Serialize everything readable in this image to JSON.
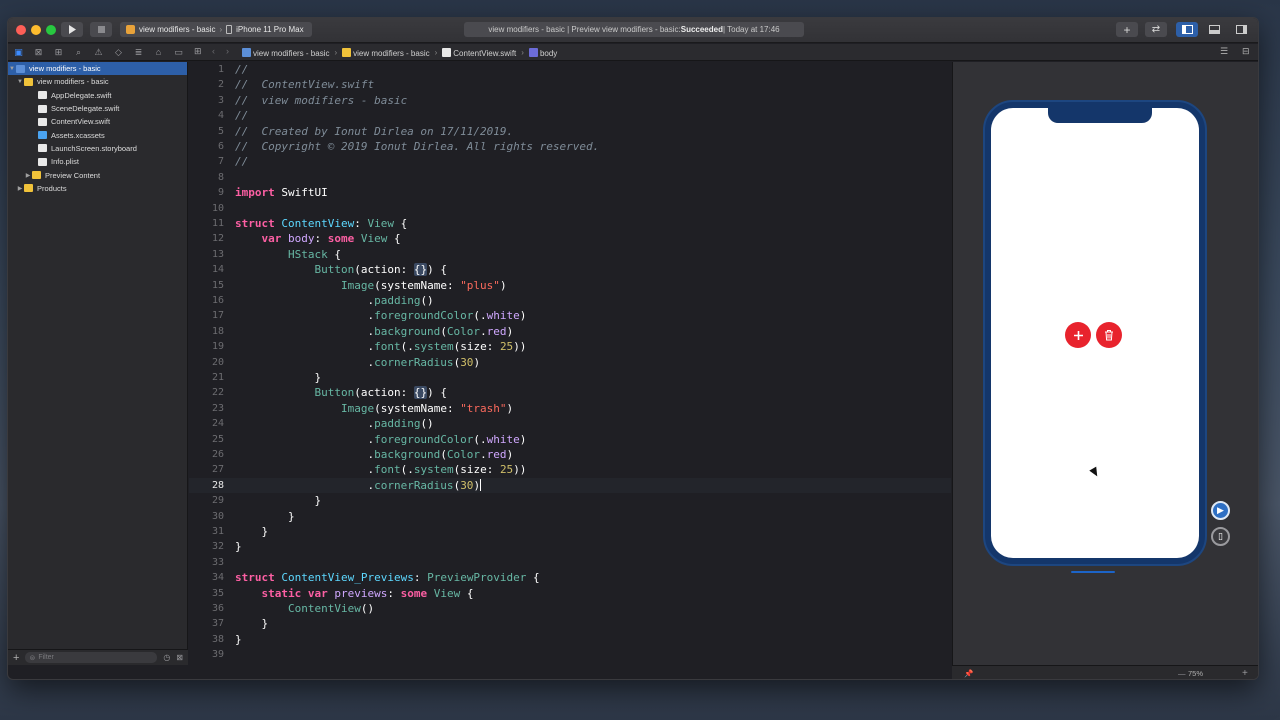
{
  "toolbar": {
    "scheme_project": "view modifiers - basic",
    "scheme_device": "iPhone 11 Pro Max",
    "status_prefix": "view modifiers - basic | Preview view modifiers - basic: ",
    "status_result": "Succeeded",
    "status_time": " | Today at 17:46"
  },
  "breadcrumb": {
    "items": [
      "view modifiers - basic",
      "view modifiers - basic",
      "ContentView.swift",
      "body"
    ]
  },
  "navigator": {
    "items": [
      {
        "label": "view modifiers - basic",
        "icon": "project-icon",
        "expanded": true,
        "selected": true
      },
      {
        "label": "view modifiers - basic",
        "icon": "folder-icon",
        "expanded": true
      },
      {
        "label": "AppDelegate.swift",
        "icon": "swift-file-icon"
      },
      {
        "label": "SceneDelegate.swift",
        "icon": "swift-file-icon"
      },
      {
        "label": "ContentView.swift",
        "icon": "swift-file-icon"
      },
      {
        "label": "Assets.xcassets",
        "icon": "asset-catalog-icon"
      },
      {
        "label": "LaunchScreen.storyboard",
        "icon": "storyboard-icon"
      },
      {
        "label": "Info.plist",
        "icon": "plist-icon"
      },
      {
        "label": "Preview Content",
        "icon": "folder-icon",
        "expanded": false
      },
      {
        "label": "Products",
        "icon": "folder-icon",
        "expanded": false
      }
    ],
    "filter_placeholder": "Filter"
  },
  "editor": {
    "current_line": 28,
    "lines": [
      [
        [
          "c-comment",
          "//"
        ]
      ],
      [
        [
          "c-comment",
          "//  ContentView.swift"
        ]
      ],
      [
        [
          "c-comment",
          "//  view modifiers - basic"
        ]
      ],
      [
        [
          "c-comment",
          "//"
        ]
      ],
      [
        [
          "c-comment",
          "//  Created by Ionut Dirlea on 17/11/2019."
        ]
      ],
      [
        [
          "c-comment",
          "//  Copyright © 2019 Ionut Dirlea. All rights reserved."
        ]
      ],
      [
        [
          "c-comment",
          "//"
        ]
      ],
      [],
      [
        [
          "c-kw",
          "import"
        ],
        [
          "c-plain",
          " SwiftUI"
        ]
      ],
      [],
      [
        [
          "c-kw",
          "struct"
        ],
        [
          "c-plain",
          " "
        ],
        [
          "c-type",
          "ContentView"
        ],
        [
          "c-plain",
          ": "
        ],
        [
          "c-fn",
          "View"
        ],
        [
          "c-plain",
          " {"
        ]
      ],
      [
        [
          "c-plain",
          "    "
        ],
        [
          "c-kw",
          "var"
        ],
        [
          "c-plain",
          " "
        ],
        [
          "c-other",
          "body"
        ],
        [
          "c-plain",
          ": "
        ],
        [
          "c-kw",
          "some"
        ],
        [
          "c-plain",
          " "
        ],
        [
          "c-fn",
          "View"
        ],
        [
          "c-plain",
          " {"
        ]
      ],
      [
        [
          "c-plain",
          "        "
        ],
        [
          "c-fn",
          "HStack"
        ],
        [
          "c-plain",
          " {"
        ]
      ],
      [
        [
          "c-plain",
          "            "
        ],
        [
          "c-fn",
          "Button"
        ],
        [
          "c-plain",
          "(action: "
        ],
        [
          "c-ph",
          "{}"
        ],
        [
          "c-plain",
          ") {"
        ]
      ],
      [
        [
          "c-plain",
          "                "
        ],
        [
          "c-fn",
          "Image"
        ],
        [
          "c-plain",
          "(systemName: "
        ],
        [
          "c-str",
          "\"plus\""
        ],
        [
          "c-plain",
          ")"
        ]
      ],
      [
        [
          "c-plain",
          "                    ."
        ],
        [
          "c-fn",
          "padding"
        ],
        [
          "c-plain",
          "()"
        ]
      ],
      [
        [
          "c-plain",
          "                    ."
        ],
        [
          "c-fn",
          "foregroundColor"
        ],
        [
          "c-plain",
          "(."
        ],
        [
          "c-other",
          "white"
        ],
        [
          "c-plain",
          ")"
        ]
      ],
      [
        [
          "c-plain",
          "                    ."
        ],
        [
          "c-fn",
          "background"
        ],
        [
          "c-plain",
          "("
        ],
        [
          "c-fn",
          "Color"
        ],
        [
          "c-plain",
          "."
        ],
        [
          "c-other",
          "red"
        ],
        [
          "c-plain",
          ")"
        ]
      ],
      [
        [
          "c-plain",
          "                    ."
        ],
        [
          "c-fn",
          "font"
        ],
        [
          "c-plain",
          "(."
        ],
        [
          "c-fn",
          "system"
        ],
        [
          "c-plain",
          "(size: "
        ],
        [
          "c-num",
          "25"
        ],
        [
          "c-plain",
          "))"
        ]
      ],
      [
        [
          "c-plain",
          "                    ."
        ],
        [
          "c-fn",
          "cornerRadius"
        ],
        [
          "c-plain",
          "("
        ],
        [
          "c-num",
          "30"
        ],
        [
          "c-plain",
          ")"
        ]
      ],
      [
        [
          "c-plain",
          "            }"
        ]
      ],
      [
        [
          "c-plain",
          "            "
        ],
        [
          "c-fn",
          "Button"
        ],
        [
          "c-plain",
          "(action: "
        ],
        [
          "c-ph",
          "{}"
        ],
        [
          "c-plain",
          ") {"
        ]
      ],
      [
        [
          "c-plain",
          "                "
        ],
        [
          "c-fn",
          "Image"
        ],
        [
          "c-plain",
          "(systemName: "
        ],
        [
          "c-str",
          "\"trash\""
        ],
        [
          "c-plain",
          ")"
        ]
      ],
      [
        [
          "c-plain",
          "                    ."
        ],
        [
          "c-fn",
          "padding"
        ],
        [
          "c-plain",
          "()"
        ]
      ],
      [
        [
          "c-plain",
          "                    ."
        ],
        [
          "c-fn",
          "foregroundColor"
        ],
        [
          "c-plain",
          "(."
        ],
        [
          "c-other",
          "white"
        ],
        [
          "c-plain",
          ")"
        ]
      ],
      [
        [
          "c-plain",
          "                    ."
        ],
        [
          "c-fn",
          "background"
        ],
        [
          "c-plain",
          "("
        ],
        [
          "c-fn",
          "Color"
        ],
        [
          "c-plain",
          "."
        ],
        [
          "c-other",
          "red"
        ],
        [
          "c-plain",
          ")"
        ]
      ],
      [
        [
          "c-plain",
          "                    ."
        ],
        [
          "c-fn",
          "font"
        ],
        [
          "c-plain",
          "(."
        ],
        [
          "c-fn",
          "system"
        ],
        [
          "c-plain",
          "(size: "
        ],
        [
          "c-num",
          "25"
        ],
        [
          "c-plain",
          "))"
        ]
      ],
      [
        [
          "c-plain",
          "                    ."
        ],
        [
          "c-fn",
          "cornerRadius"
        ],
        [
          "c-plain",
          "("
        ],
        [
          "c-num",
          "30"
        ],
        [
          "c-plain",
          ")"
        ]
      ],
      [
        [
          "c-plain",
          "            }"
        ]
      ],
      [
        [
          "c-plain",
          "        }"
        ]
      ],
      [
        [
          "c-plain",
          "    }"
        ]
      ],
      [
        [
          "c-plain",
          "}"
        ]
      ],
      [],
      [
        [
          "c-kw",
          "struct"
        ],
        [
          "c-plain",
          " "
        ],
        [
          "c-type",
          "ContentView_Previews"
        ],
        [
          "c-plain",
          ": "
        ],
        [
          "c-fn",
          "PreviewProvider"
        ],
        [
          "c-plain",
          " {"
        ]
      ],
      [
        [
          "c-plain",
          "    "
        ],
        [
          "c-kw",
          "static"
        ],
        [
          "c-plain",
          " "
        ],
        [
          "c-kw",
          "var"
        ],
        [
          "c-plain",
          " "
        ],
        [
          "c-other",
          "previews"
        ],
        [
          "c-plain",
          ": "
        ],
        [
          "c-kw",
          "some"
        ],
        [
          "c-plain",
          " "
        ],
        [
          "c-fn",
          "View"
        ],
        [
          "c-plain",
          " {"
        ]
      ],
      [
        [
          "c-plain",
          "        "
        ],
        [
          "c-fn",
          "ContentView"
        ],
        [
          "c-plain",
          "()"
        ]
      ],
      [
        [
          "c-plain",
          "    }"
        ]
      ],
      [
        [
          "c-plain",
          "}"
        ]
      ],
      []
    ]
  },
  "preview": {
    "buttons": [
      "plus-icon",
      "trash-icon"
    ],
    "zoom_label": "75%"
  },
  "colors": {
    "accent": "#2d5fa8",
    "button_red": "#e8232d",
    "device_frame": "#14366a"
  }
}
